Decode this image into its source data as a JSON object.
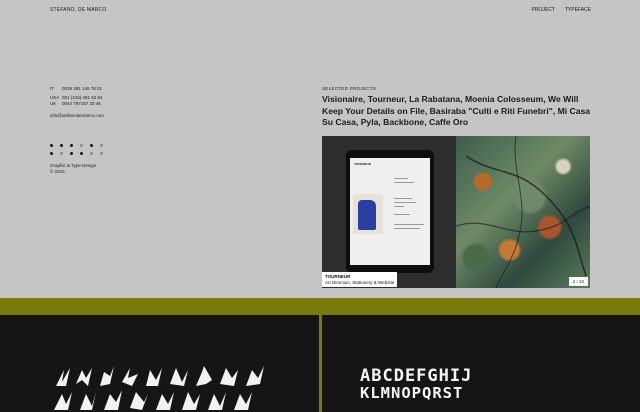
{
  "header": {
    "site_name": "STEFANO, DE MARCO",
    "nav": [
      "PROJECT",
      "TYPEFACE"
    ]
  },
  "contact": {
    "phones": [
      {
        "country": "IT",
        "number": "0039 391 146 78 01"
      },
      {
        "country": "USA",
        "number": "001 (415) 481 52 84"
      },
      {
        "country": "UK",
        "number": "0044 797167 33 46"
      }
    ],
    "email": "info@stefanodemarco.com"
  },
  "dot_grid": {
    "rows": [
      [
        "dark",
        "dark",
        "dark",
        "light",
        "dark",
        "light"
      ],
      [
        "dark",
        "light",
        "dark",
        "dark",
        "light",
        "light"
      ]
    ]
  },
  "credits": {
    "line1": "Graphic & Type Design",
    "line2": "© 2016"
  },
  "selected": {
    "label": "SELECTED PROJECTS",
    "list": "Visionaire, Tourneur, La Rabatana, Moenia Colosseum, We Will Keep Your Details on File, Basiraba \"Culti e Riti Funebri\", Mi Casa Su Casa, Pyla, Backbone, Caffe Oro"
  },
  "slide": {
    "title": "TOURNEUR",
    "subtitle": "Art Direction, Stationery & Website",
    "counter": "2 / 10",
    "tablet_brand": "TOURNEUR"
  },
  "typeface_b": {
    "row1": "ABCDEFGHIJ",
    "row2": "KLMNOPQRST"
  },
  "colors": {
    "background": "#c5c5c5",
    "accent_band": "#7a7a0c",
    "panel": "#151515"
  }
}
